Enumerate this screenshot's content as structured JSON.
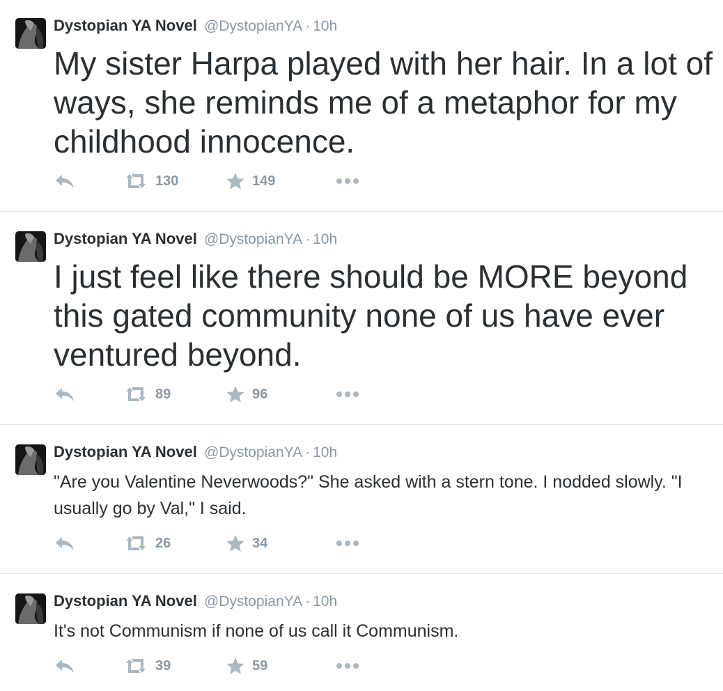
{
  "tweets": [
    {
      "name": "Dystopian YA Novel",
      "handle": "@DystopianYA",
      "separator": "·",
      "time": "10h",
      "text": "My sister Harpa played with her hair. In a lot of ways, she reminds me of a metaphor for my childhood innocence.",
      "retweets": "130",
      "favorites": "149"
    },
    {
      "name": "Dystopian YA Novel",
      "handle": "@DystopianYA",
      "separator": "·",
      "time": "10h",
      "text": "I just feel like there should be MORE beyond this gated community none of us have ever ventured beyond.",
      "retweets": "89",
      "favorites": "96"
    },
    {
      "name": "Dystopian YA Novel",
      "handle": "@DystopianYA",
      "separator": "·",
      "time": "10h",
      "text": "\"Are you Valentine Neverwoods?\" She asked with a stern tone. I nodded slowly. \"I usually go by Val,\" I said.",
      "retweets": "26",
      "favorites": "34"
    },
    {
      "name": "Dystopian YA Novel",
      "handle": "@DystopianYA",
      "separator": "·",
      "time": "10h",
      "text": "It's not Communism if none of us call it Communism.",
      "retweets": "39",
      "favorites": "59"
    }
  ],
  "icons": {
    "reply": "reply-icon",
    "retweet": "retweet-icon",
    "favorite": "star-icon",
    "more": "more-icon"
  },
  "colors": {
    "name": "#292f33",
    "meta": "#8899a6",
    "icon": "#aab8c2",
    "divider": "#e1e8ed"
  }
}
